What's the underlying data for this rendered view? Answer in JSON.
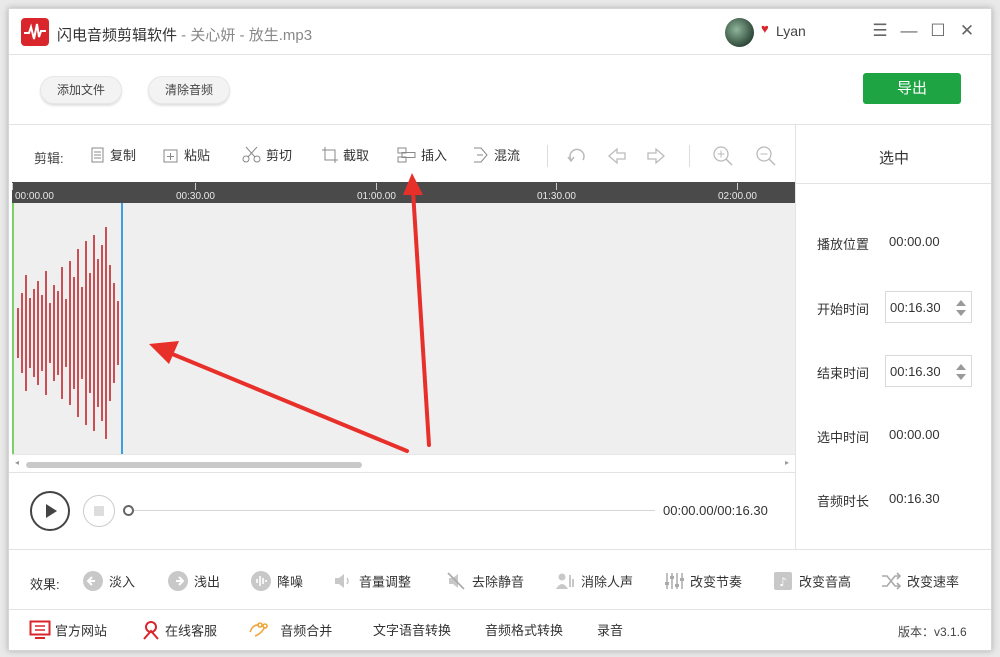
{
  "window": {
    "title_app": "闪电音频剪辑软件",
    "title_sep": " - ",
    "title_file": "关心妍 - 放生.mp3",
    "user": "Lyan"
  },
  "toolbar": {
    "add_file": "添加文件",
    "clear_audio": "清除音频",
    "export": "导出"
  },
  "edit": {
    "label": "剪辑:",
    "copy": "复制",
    "paste": "粘贴",
    "cut": "剪切",
    "crop": "截取",
    "insert": "插入",
    "mix": "混流"
  },
  "timeline": {
    "ticks": [
      "00:00.00",
      "00:30.00",
      "01:00.00",
      "01:30.00",
      "02:00.00"
    ]
  },
  "player": {
    "time": "00:00.00/00:16.30"
  },
  "side_panel": {
    "header": "选中",
    "play_pos_label": "播放位置",
    "play_pos_value": "00:00.00",
    "start_label": "开始时间",
    "start_value": "00:16.30",
    "end_label": "结束时间",
    "end_value": "00:16.30",
    "sel_label": "选中时间",
    "sel_value": "00:00.00",
    "dur_label": "音频时长",
    "dur_value": "00:16.30"
  },
  "effects": {
    "label": "效果:",
    "fade_in": "淡入",
    "fade_out": "浅出",
    "denoise": "降噪",
    "volume": "音量调整",
    "remove_silence": "去除静音",
    "remove_vocal": "消除人声",
    "tempo": "改变节奏",
    "pitch": "改变音高",
    "speed": "改变速率"
  },
  "footer": {
    "website": "官方网站",
    "support": "在线客服",
    "merge": "音频合并",
    "tts": "文字语音转换",
    "format": "音频格式转换",
    "record": "录音",
    "version": "版本：v3.1.6"
  },
  "colors": {
    "brand_red": "#d8262c",
    "export_green": "#1fa443",
    "waveform": "#c0262c",
    "cursor_blue": "#3aa0e0",
    "start_marker": "#7bd06a",
    "arrow_red": "#e8302a"
  }
}
